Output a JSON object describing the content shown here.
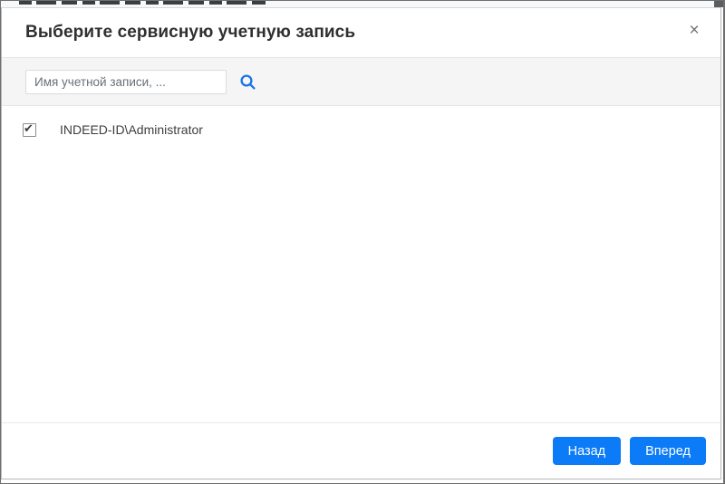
{
  "modal": {
    "title": "Выберите сервисную учетную запись",
    "search": {
      "placeholder": "Имя учетной записи, ..."
    },
    "accounts": [
      {
        "name": "INDEED-ID\\Administrator",
        "checked": true
      }
    ],
    "buttons": {
      "back": "Назад",
      "next": "Вперед"
    },
    "icons": {
      "close": "×",
      "check": "✔",
      "search": "magnifier"
    },
    "colors": {
      "primary_button": "#0b7bf7",
      "search_icon": "#1a73e8",
      "search_bar_background": "#f5f5f6",
      "title_text": "#2e2f31"
    }
  }
}
